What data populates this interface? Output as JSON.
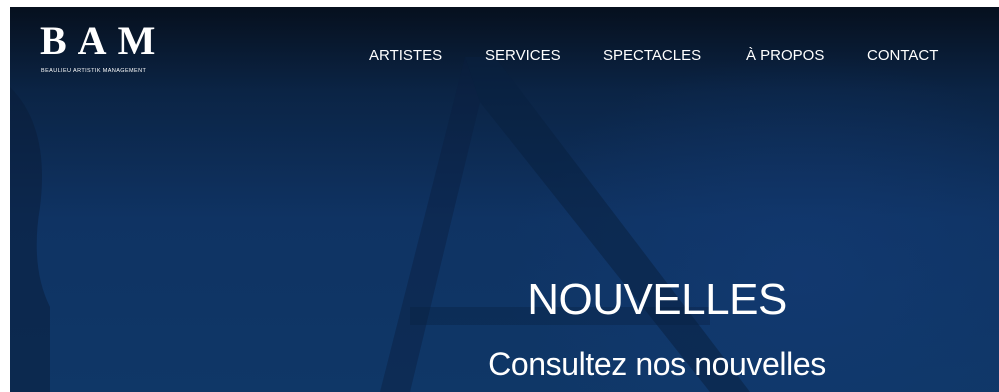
{
  "brand": {
    "mark": "BAM",
    "tagline": "BEAULIEU ARTISTIK MANAGEMENT"
  },
  "nav": {
    "items": [
      {
        "label": "ARTISTES"
      },
      {
        "label": "SERVICES"
      },
      {
        "label": "SPECTACLES"
      },
      {
        "label": "À PROPOS"
      },
      {
        "label": "CONTACT"
      }
    ]
  },
  "hero": {
    "title": "NOUVELLES",
    "subtitle": "Consultez nos nouvelles"
  },
  "colors": {
    "hero_top": "#06101e",
    "hero_bottom": "#0f3767",
    "text": "#ffffff"
  }
}
